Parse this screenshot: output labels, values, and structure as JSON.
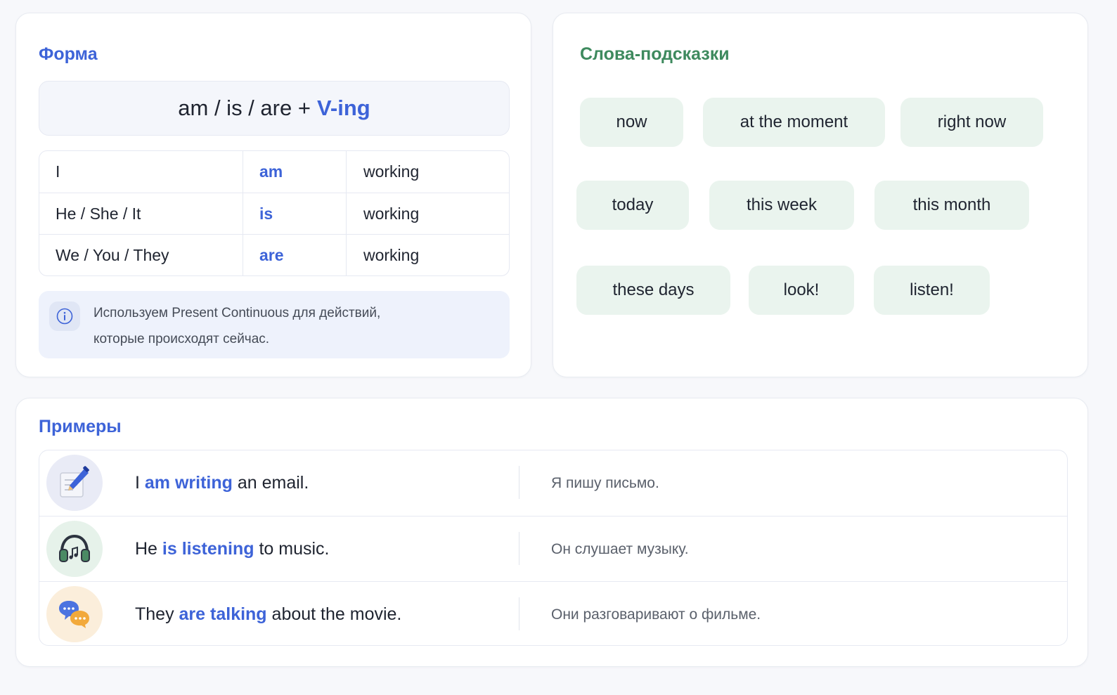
{
  "forma": {
    "title": "Форма",
    "formula_base": "am / is / are +",
    "formula_accent": "V-ing",
    "rows": [
      {
        "subject": "I",
        "aux": "am",
        "verb": "working"
      },
      {
        "subject": "He / She / It",
        "aux": "is",
        "verb": "working"
      },
      {
        "subject": "We / You / They",
        "aux": "are",
        "verb": "working"
      }
    ],
    "note": {
      "icon": "info-icon",
      "line1": "Используем Present Continuous для действий,",
      "line2": "которые происходят сейчас."
    }
  },
  "hints": {
    "title": "Слова-подсказки",
    "chips": [
      "now",
      "at the moment",
      "right now",
      "today",
      "this week",
      "this month",
      "these days",
      "look!",
      "listen!"
    ]
  },
  "examples": {
    "title": "Примеры",
    "rows": [
      {
        "icon": "pencil-note-icon",
        "before": "I ",
        "highlight": "am writing",
        "after": " an email.",
        "translation": "Я пишу письмо."
      },
      {
        "icon": "headphones-icon",
        "before": "He ",
        "highlight": "is listening",
        "after": " to music.",
        "translation": "Он слушает музыку."
      },
      {
        "icon": "chat-bubbles-icon",
        "before": "They ",
        "highlight": "are talking",
        "after": " about the movie.",
        "translation": "Они разговаривают о фильме."
      }
    ]
  },
  "colors": {
    "accent_blue": "#3d63d8",
    "accent_green": "#3e8a5e",
    "chip_bg": "#eaf4ee",
    "note_bg": "#eef2fc"
  }
}
